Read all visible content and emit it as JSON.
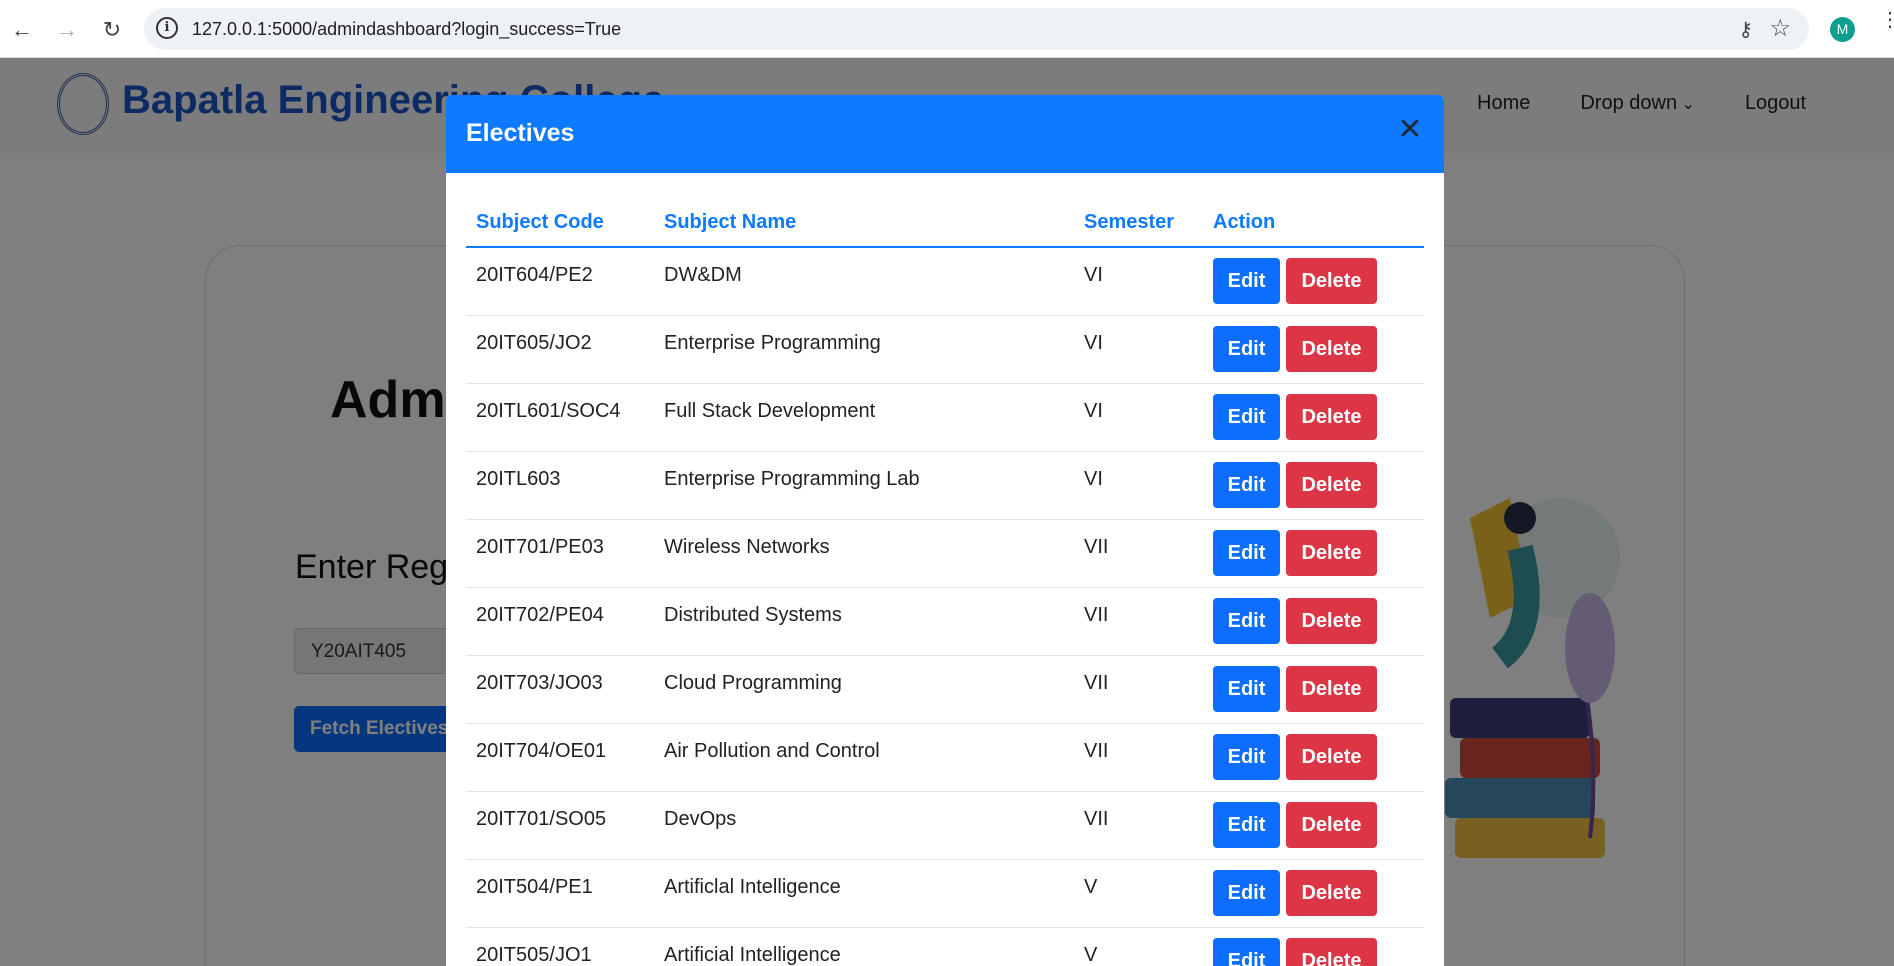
{
  "browser": {
    "url": "127.0.0.1:5000/admindashboard?login_success=True",
    "avatar_letter": "M"
  },
  "navbar": {
    "brand": "Bapatla Engineering College",
    "links": [
      "Home",
      "Drop down",
      "Logout"
    ]
  },
  "page": {
    "admin_title": "Admin",
    "enter_label": "Enter Reg",
    "reg_value": "Y20AIT405",
    "fetch_button": "Fetch Electives"
  },
  "modal": {
    "title": "Electives",
    "headers": [
      "Subject Code",
      "Subject Name",
      "Semester",
      "Action"
    ],
    "edit_label": "Edit",
    "delete_label": "Delete",
    "rows": [
      {
        "code": "20IT604/PE2",
        "name": "DW&DM",
        "sem": "VI"
      },
      {
        "code": "20IT605/JO2",
        "name": "Enterprise Programming",
        "sem": "VI"
      },
      {
        "code": "20ITL601/SOC4",
        "name": "Full Stack Development",
        "sem": "VI"
      },
      {
        "code": "20ITL603",
        "name": "Enterprise Programming Lab",
        "sem": "VI"
      },
      {
        "code": "20IT701/PE03",
        "name": "Wireless Networks",
        "sem": "VII"
      },
      {
        "code": "20IT702/PE04",
        "name": "Distributed Systems",
        "sem": "VII"
      },
      {
        "code": "20IT703/JO03",
        "name": "Cloud Programming",
        "sem": "VII"
      },
      {
        "code": "20IT704/OE01",
        "name": "Air Pollution and Control",
        "sem": "VII"
      },
      {
        "code": "20IT701/SO05",
        "name": "DevOps",
        "sem": "VII"
      },
      {
        "code": "20IT504/PE1",
        "name": "Artificlal Intelligence",
        "sem": "V"
      },
      {
        "code": "20IT505/JO1",
        "name": "Artificial Intelligence",
        "sem": "V"
      }
    ]
  }
}
